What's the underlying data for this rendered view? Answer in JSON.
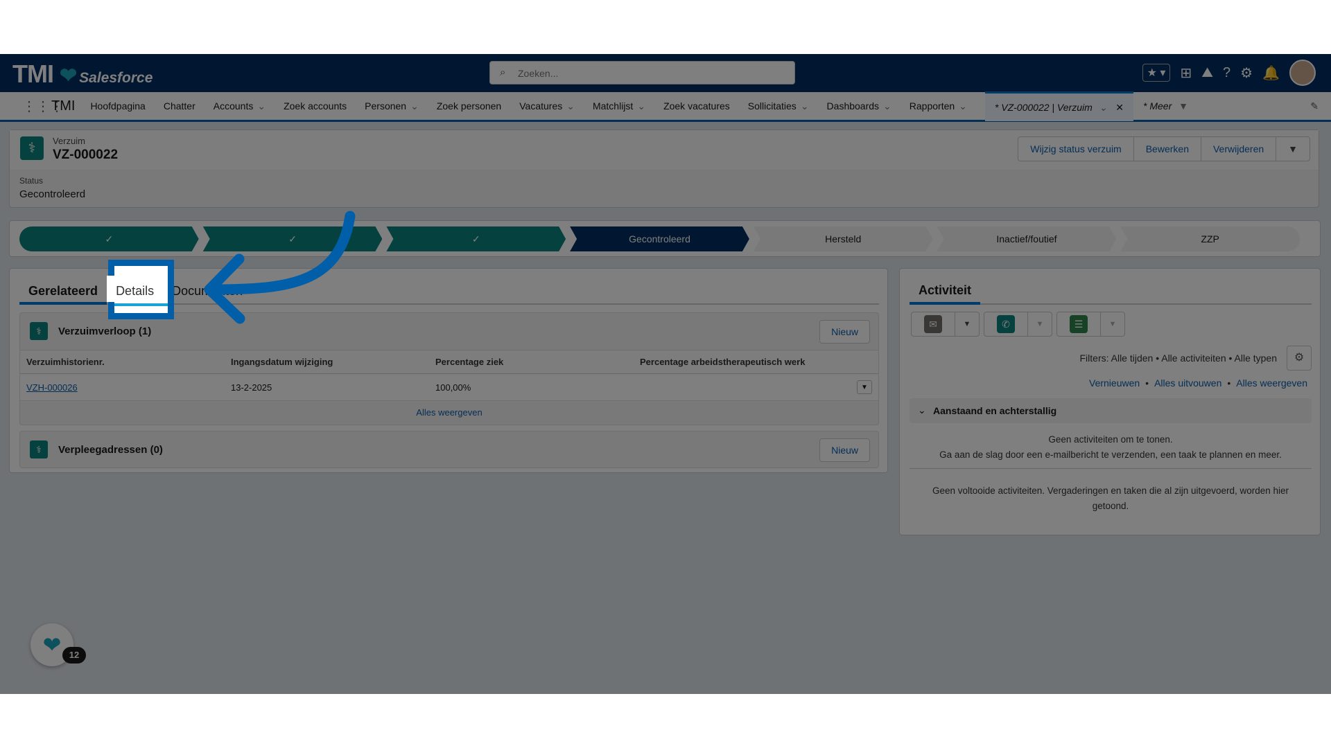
{
  "header": {
    "logo": "TMI",
    "logo_sub": "Salesforce",
    "search_placeholder": "Zoeken..."
  },
  "nav": {
    "app": "TMI",
    "items": [
      {
        "label": "Hoofdpagina",
        "menu": false
      },
      {
        "label": "Chatter",
        "menu": false
      },
      {
        "label": "Accounts",
        "menu": true
      },
      {
        "label": "Zoek accounts",
        "menu": false
      },
      {
        "label": "Personen",
        "menu": true
      },
      {
        "label": "Zoek personen",
        "menu": false
      },
      {
        "label": "Vacatures",
        "menu": true
      },
      {
        "label": "Matchlijst",
        "menu": true
      },
      {
        "label": "Zoek vacatures",
        "menu": false
      },
      {
        "label": "Sollicitaties",
        "menu": true
      },
      {
        "label": "Dashboards",
        "menu": true
      },
      {
        "label": "Rapporten",
        "menu": true
      }
    ],
    "active_tab": "* VZ-000022 | Verzuim",
    "more": "* Meer"
  },
  "record": {
    "type": "Verzuim",
    "name": "VZ-000022",
    "actions": [
      "Wijzig status verzuim",
      "Bewerken",
      "Verwijderen"
    ],
    "status_label": "Status",
    "status_value": "Gecontroleerd"
  },
  "path": {
    "steps": [
      "",
      "",
      "",
      "Gecontroleerd",
      "Hersteld",
      "Inactief/foutief",
      "ZZP"
    ],
    "completed_mark": "✓"
  },
  "tabs": [
    "Gerelateerd",
    "Details",
    "Documenten"
  ],
  "related": {
    "verzuimverloop": {
      "title": "Verzuimverloop (1)",
      "new": "Nieuw",
      "columns": [
        "Verzuimhistorienr.",
        "Ingangsdatum wijziging",
        "Percentage ziek",
        "Percentage arbeidstherapeutisch werk"
      ],
      "rows": [
        [
          "VZH-000026",
          "13-2-2025",
          "100,00%",
          ""
        ]
      ],
      "view_all": "Alles weergeven"
    },
    "verpleegadressen": {
      "title": "Verpleegadressen (0)",
      "new": "Nieuw"
    }
  },
  "activity": {
    "tab": "Activiteit",
    "filters": "Filters: Alle tijden • Alle activiteiten • Alle typen",
    "links": [
      "Vernieuwen",
      "Alles uitvouwen",
      "Alles weergeven"
    ],
    "section": "Aanstaand en achterstallig",
    "empty1": "Geen activiteiten om te tonen.",
    "empty2": "Ga aan de slag door een e-mailbericht te verzenden, een taak te plannen en meer.",
    "done": "Geen voltooide activiteiten. Vergaderingen en taken die al zijn uitgevoerd, worden hier getoond."
  },
  "help": {
    "badge": "12"
  },
  "highlight": {
    "label": "Details",
    "color": "#005fa8"
  }
}
